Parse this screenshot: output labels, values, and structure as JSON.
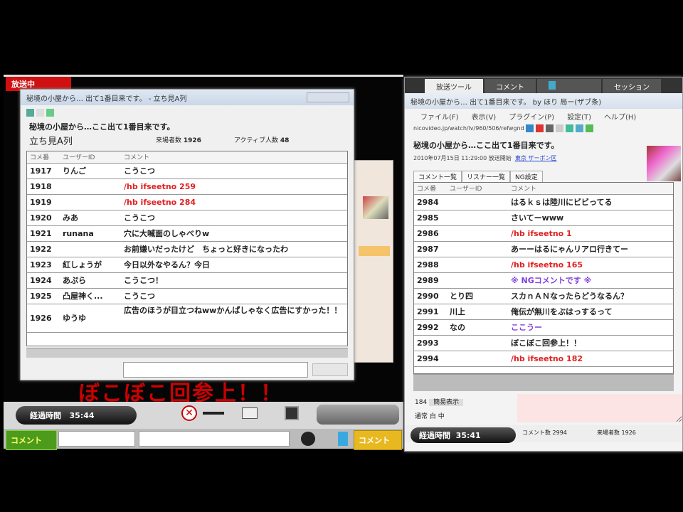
{
  "player": {
    "onair_label": "放送中",
    "overlay_text": "ぼこぼこ回参上！！",
    "elapsed_label": "経過時間",
    "elapsed_time": "35:44",
    "comment_button": "コメント",
    "submit_button": "コメント"
  },
  "left_window": {
    "title": "秘境の小屋から… 出て1番目来です。 - 立ち見A列",
    "program_title": "秘境の小屋から…ここ出て1番目来です。",
    "seat": "立ち見A列",
    "visitors_label": "来場者数",
    "visitors": "1926",
    "active_label": "アクティブ人数",
    "active": "48",
    "columns": [
      "コメ番",
      "ユーザーID",
      "コメント"
    ],
    "rows": [
      {
        "no": "1917",
        "name": "りんご",
        "text": "こうこつ",
        "color": "normal"
      },
      {
        "no": "1918",
        "name": "",
        "text": "/hb ifseetno 259",
        "color": "red"
      },
      {
        "no": "1919",
        "name": "",
        "text": "/hb ifseetno 284",
        "color": "red"
      },
      {
        "no": "1920",
        "name": "みあ",
        "text": "こうこつ",
        "color": "normal"
      },
      {
        "no": "1921",
        "name": "runana",
        "text": "穴に大喊面のしゃべりw",
        "color": "normal"
      },
      {
        "no": "1922",
        "name": "",
        "text": "お前嫌いだったけど　ちょっと好きになったわ",
        "color": "normal"
      },
      {
        "no": "1923",
        "name": "紅しょうが",
        "text": "今日以外なやるん？今日",
        "color": "normal"
      },
      {
        "no": "1924",
        "name": "あぷら",
        "text": "こうこつ！",
        "color": "normal"
      },
      {
        "no": "1925",
        "name": "凸屋神く...",
        "text": "こうこつ",
        "color": "normal"
      },
      {
        "no": "1926",
        "name": "ゆうゆ",
        "text": "広告のほうが目立つねwwかんぱしゃなく広告にすかった！！",
        "color": "normal"
      }
    ]
  },
  "right_window": {
    "tabs": [
      "放送ツール",
      "コメント",
      "",
      "セッション"
    ],
    "title": "秘境の小屋から… 出て1番目来です。 by ほり 局ー(ザブ条)",
    "menu": [
      "ファイル(F)",
      "表示(V)",
      "プラグイン(P)",
      "設定(T)",
      "ヘルプ(H)"
    ],
    "url": "nicovideo.jp/watch/lv/960/506/refwgnd",
    "program_title": "秘境の小屋から…ここ出て1番目来です。",
    "info": "2010年07月15日 11:29:00 放送開始",
    "community_link": "東京 ザーボン区",
    "subtabs": [
      "コメント一覧",
      "リスナー一覧",
      "NG設定"
    ],
    "columns": [
      "コメ番",
      "ユーザーID",
      "コメント"
    ],
    "rows": [
      {
        "no": "2984",
        "name": "",
        "text": "はるｋｓは陸川にビビってる",
        "color": "normal"
      },
      {
        "no": "2985",
        "name": "",
        "text": "さいてーwww",
        "color": "normal"
      },
      {
        "no": "2986",
        "name": "",
        "text": "/hb ifseetno 1",
        "color": "red"
      },
      {
        "no": "2987",
        "name": "",
        "text": "あーーはるにゃんリアロ行きてー",
        "color": "normal"
      },
      {
        "no": "2988",
        "name": "",
        "text": "/hb ifseetno 165",
        "color": "red"
      },
      {
        "no": "2989",
        "name": "",
        "text": "※ NGコメントです ※",
        "color": "purple"
      },
      {
        "no": "2990",
        "name": "とり四",
        "text": "スカｎＡＮなったらどうなるん？",
        "color": "normal"
      },
      {
        "no": "2991",
        "name": "川上",
        "text": "俺伝が無川をぶはっするって",
        "color": "normal"
      },
      {
        "no": "2992",
        "name": "なの",
        "text": "ここうー",
        "color": "purple"
      },
      {
        "no": "2993",
        "name": "",
        "text": "ぼこぼこ回参上！！",
        "color": "normal"
      },
      {
        "no": "2994",
        "name": "",
        "text": "/hb ifseetno 182",
        "color": "red"
      }
    ],
    "options": [
      "184",
      "簡易表示",
      "通常",
      "白",
      "中"
    ],
    "elapsed_label": "経過時間",
    "elapsed_time": "35:41",
    "status_comments": "コメント数 2994",
    "status_visitors": "来場者数 1926"
  }
}
